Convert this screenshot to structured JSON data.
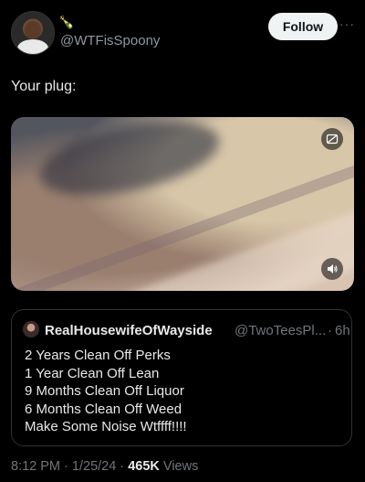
{
  "author": {
    "emoji": "🍾",
    "handle": "@WTFisSpoony",
    "follow_label": "Follow"
  },
  "post": {
    "text": "Your plug:"
  },
  "quoted": {
    "display_name": "RealHousewifeOfWayside",
    "handle": "@TwoTeesPl...",
    "separator": "·",
    "time": "6h",
    "lines": [
      "2 Years Clean Off Perks",
      "1 Year Clean Off Lean",
      "9 Months Clean Off Liquor",
      "6 Months Clean Off Weed",
      "Make Some Noise Wtffff!!!!"
    ]
  },
  "meta": {
    "time": "8:12 PM",
    "date": "1/25/24",
    "separator": "·",
    "views_count": "465K",
    "views_label": "Views"
  },
  "colors": {
    "background": "#000000",
    "text_primary": "#e7e9ea",
    "text_secondary": "#71767b",
    "border": "#2f3336",
    "follow_button_bg": "#eff3f4"
  },
  "icons": {
    "more": "more-horizontal-icon",
    "gif_toggle": "image-toggle-icon",
    "volume": "volume-icon"
  }
}
